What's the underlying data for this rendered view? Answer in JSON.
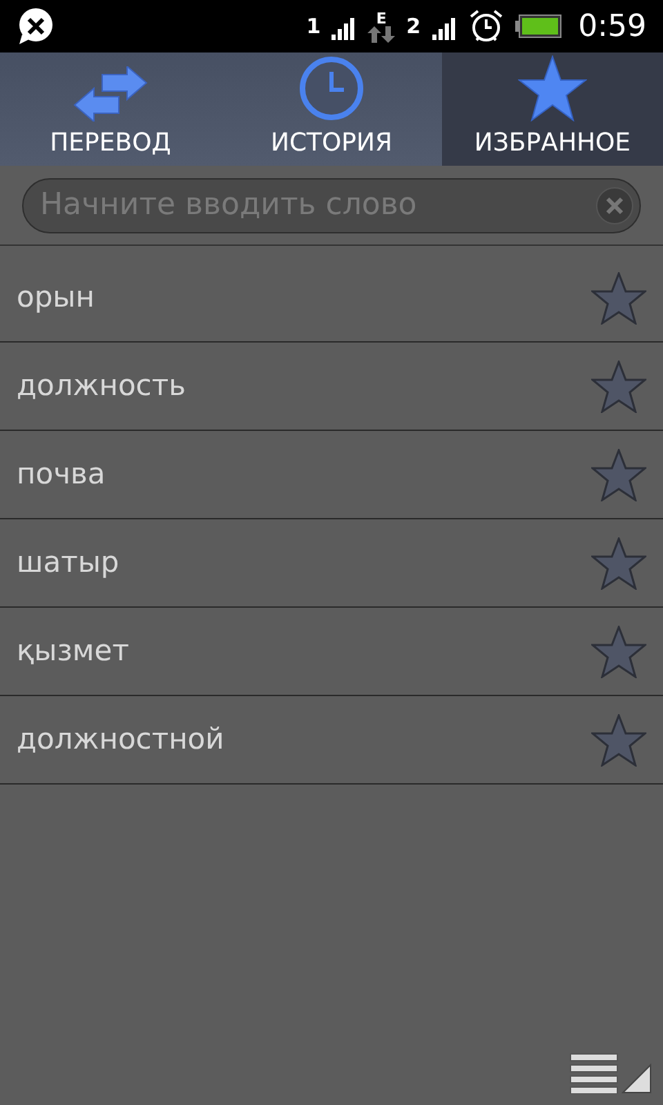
{
  "status_bar": {
    "sim1": "1",
    "network": "E",
    "sim2": "2",
    "time": "0:59"
  },
  "tabs": [
    {
      "label": "ПЕРЕВОД",
      "kind": "arrows",
      "selected": false
    },
    {
      "label": "ИСТОРИЯ",
      "kind": "clock",
      "selected": false
    },
    {
      "label": "ИЗБРАННОЕ",
      "kind": "star",
      "selected": true
    }
  ],
  "search": {
    "placeholder": "Начните вводить слово"
  },
  "words": [
    {
      "text": "орын"
    },
    {
      "text": "должность"
    },
    {
      "text": "почва"
    },
    {
      "text": "шатыр"
    },
    {
      "text": "қызмет"
    },
    {
      "text": "должностной"
    }
  ]
}
